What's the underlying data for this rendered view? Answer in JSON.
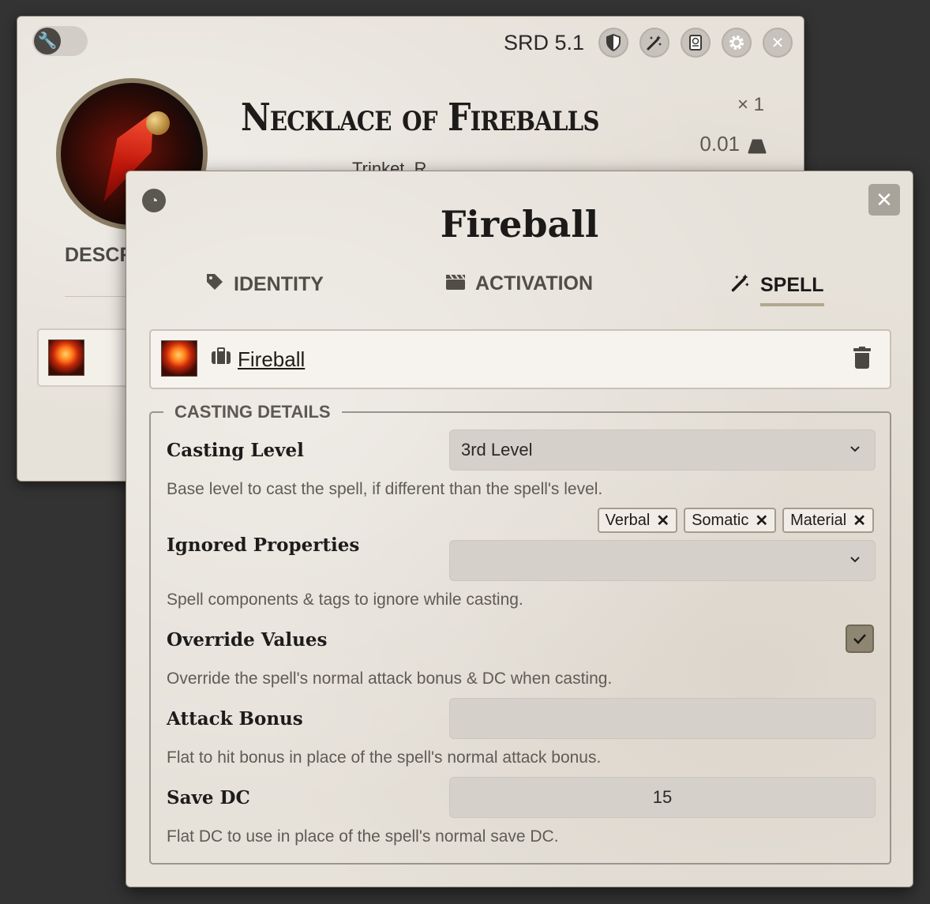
{
  "back_sheet": {
    "source_label": "SRD 5.1",
    "item_name": "Necklace of Fireballs",
    "item_subtitle": "Trinket, R",
    "quantity": "× 1",
    "weight": "0.01",
    "desc_tab": "DESCR",
    "header_icons": [
      "shield-icon",
      "magic-wand-icon",
      "scroll-icon",
      "gear-icon",
      "close-icon"
    ]
  },
  "dialog": {
    "title": "Fireball",
    "tabs": [
      {
        "label": "IDENTITY",
        "icon": "tag-icon",
        "active": false
      },
      {
        "label": "ACTIVATION",
        "icon": "clapperboard-icon",
        "active": false
      },
      {
        "label": "SPELL",
        "icon": "magic-wand-icon",
        "active": true
      }
    ],
    "spell_row": {
      "name": "Fireball"
    },
    "casting": {
      "legend": "CASTING DETAILS",
      "casting_level": {
        "label": "Casting Level",
        "value": "3rd Level",
        "hint": "Base level to cast the spell, if different than the spell's level."
      },
      "ignored": {
        "label": "Ignored Properties",
        "tags": [
          "Verbal",
          "Somatic",
          "Material"
        ],
        "hint": "Spell components & tags to ignore while casting."
      },
      "override": {
        "label": "Override Values",
        "checked": true,
        "hint": "Override the spell's normal attack bonus & DC when casting."
      },
      "attack_bonus": {
        "label": "Attack Bonus",
        "value": "",
        "hint": "Flat to hit bonus in place of the spell's normal attack bonus."
      },
      "save_dc": {
        "label": "Save DC",
        "value": "15",
        "hint": "Flat DC to use in place of the spell's normal save DC."
      }
    }
  },
  "colors": {
    "background": "#333333",
    "parchment": "#e6e1d9",
    "accent": "#8e8672",
    "tab_underline": "#b2a88f"
  }
}
